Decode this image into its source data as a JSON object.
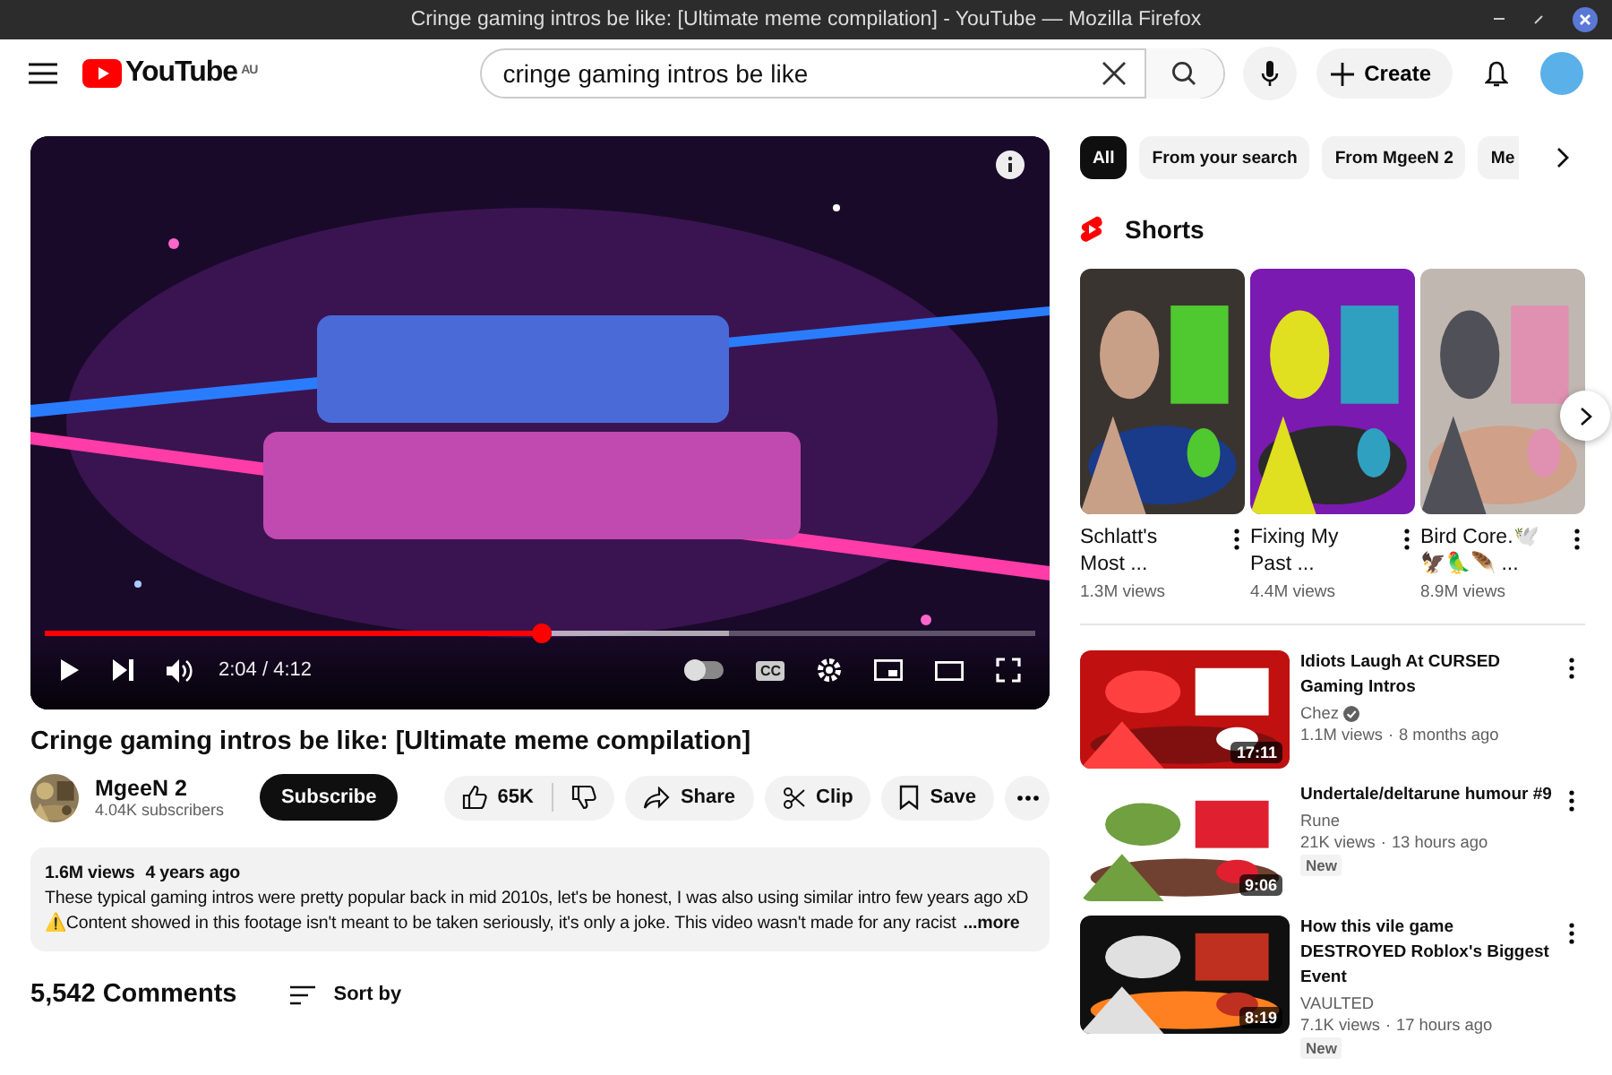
{
  "window": {
    "title": "Cringe gaming intros be like: [Ultimate meme compilation] - YouTube — Mozilla Firefox"
  },
  "masthead": {
    "logo": "YouTube",
    "country": "AU",
    "search": {
      "value": "cringe gaming intros be like"
    },
    "create": "Create"
  },
  "player": {
    "progress": {
      "level": 0.5
    },
    "buffer": {
      "level": 0.69
    },
    "time": "2:04 / 4:12",
    "autoplay": {
      "on": false
    },
    "captions": "CC"
  },
  "video": {
    "title": "Cringe gaming intros be like: [Ultimate meme compilation]",
    "channel": "MgeeN 2",
    "subscribers": "4.04K subscribers",
    "subscribe": "Subscribe",
    "likes": "65K",
    "actions": [
      {
        "kind": "share",
        "label": "Share"
      },
      {
        "kind": "clip",
        "label": "Clip"
      },
      {
        "kind": "save",
        "label": "Save"
      }
    ]
  },
  "description": {
    "views": "1.6M views",
    "age": "4 years ago",
    "paragraphs": [
      "These typical gaming intros were pretty popular back in mid 2010s, let's be honest, I was also using similar intro few years ago xD",
      "⚠️Content showed in this footage isn't meant to be taken seriously, it's only a joke. This video wasn't made for any racist"
    ],
    "more": "...more"
  },
  "comments": {
    "count": "5,542 Comments",
    "sort": "Sort by"
  },
  "chips": [
    {
      "label": "All",
      "selected": true
    },
    {
      "label": "From your search",
      "selected": false
    },
    {
      "label": "From MgeeN 2",
      "selected": false
    },
    {
      "label": "Me",
      "selected": false
    }
  ],
  "shorts": {
    "heading": "Shorts",
    "items": [
      {
        "title": "Schlatt's Most ...",
        "views": "1.3M views"
      },
      {
        "title": "Fixing My Past ...",
        "views": "4.4M views"
      },
      {
        "title": "Bird Core.🕊️ 🦅🦜🪶 ...",
        "views": "8.9M views"
      }
    ]
  },
  "videos": [
    {
      "title": "Idiots Laugh At CURSED Gaming Intros",
      "channel": "Chez",
      "verified": true,
      "views": "1.1M views",
      "separator": "·",
      "age": "8 months ago",
      "duration": "17:11",
      "new": false
    },
    {
      "title": "Undertale/deltarune humour #9",
      "channel": "Rune",
      "verified": false,
      "views": "21K views",
      "separator": "·",
      "age": "13 hours ago",
      "duration": "9:06",
      "new": true,
      "badge": "New"
    },
    {
      "title": "How this vile game DESTROYED Roblox's Biggest Event",
      "channel": "VAULTED",
      "verified": false,
      "views": "7.1K views",
      "separator": "·",
      "age": "17 hours ago",
      "duration": "8:19",
      "new": true,
      "badge": "New"
    }
  ]
}
